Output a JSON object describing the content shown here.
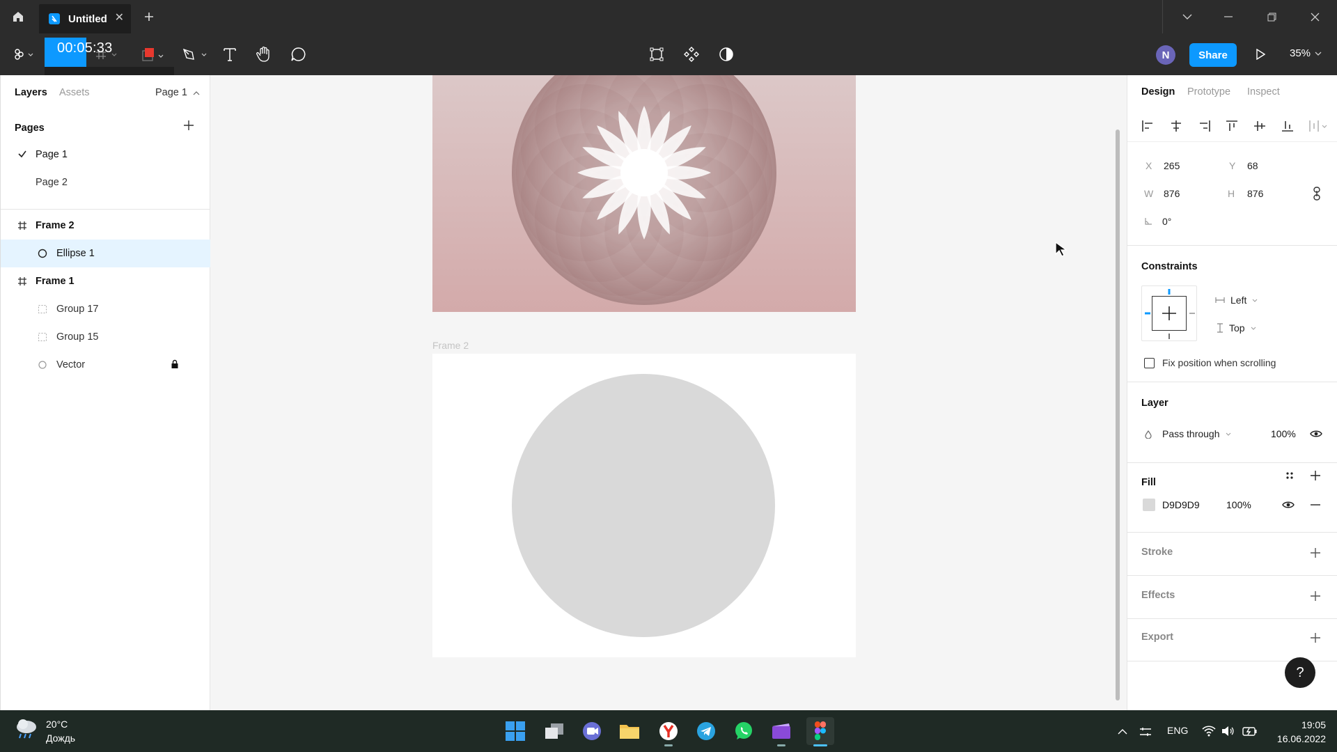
{
  "titlebar": {
    "tab_title": "Untitled",
    "tab_close": "✕",
    "new_tab": "+"
  },
  "toolbar": {
    "timer": "00:05:33",
    "avatar_initial": "N",
    "share_label": "Share",
    "zoom": "35%",
    "fill_swatch_color": "#e8382e"
  },
  "left_panel": {
    "tabs": [
      "Layers",
      "Assets"
    ],
    "page_selector": "Page 1",
    "pages_header": "Pages",
    "pages": [
      {
        "label": "Page 1",
        "current": true
      },
      {
        "label": "Page 2",
        "current": false
      }
    ],
    "layers": [
      {
        "label": "Frame 2",
        "type": "frame",
        "selected": false
      },
      {
        "label": "Ellipse 1",
        "type": "ellipse",
        "selected": true
      },
      {
        "label": "Frame 1",
        "type": "frame",
        "selected": false
      },
      {
        "label": "Group 17",
        "type": "group",
        "selected": false
      },
      {
        "label": "Group 15",
        "type": "group",
        "selected": false
      },
      {
        "label": "Vector",
        "type": "vector",
        "selected": false,
        "locked": true
      }
    ]
  },
  "canvas": {
    "frame2_label": "Frame 2",
    "ellipse_color": "#d9d9d9"
  },
  "right_panel": {
    "tabs": [
      "Design",
      "Prototype",
      "Inspect"
    ],
    "position": {
      "x_label": "X",
      "x": "265",
      "y_label": "Y",
      "y": "68"
    },
    "size": {
      "w_label": "W",
      "w": "876",
      "h_label": "H",
      "h": "876"
    },
    "rotation": "0°",
    "constraints": {
      "title": "Constraints",
      "horizontal": "Left",
      "vertical": "Top",
      "fix_position_label": "Fix position when scrolling"
    },
    "layer": {
      "title": "Layer",
      "blend": "Pass through",
      "opacity": "100%"
    },
    "fill": {
      "title": "Fill",
      "hex": "D9D9D9",
      "opacity": "100%"
    },
    "stroke": {
      "title": "Stroke"
    },
    "effects": {
      "title": "Effects"
    },
    "export": {
      "title": "Export"
    },
    "help": "?"
  },
  "taskbar": {
    "weather_temp": "20°C",
    "weather_cond": "Дождь",
    "lang": "ENG",
    "time": "19:05",
    "date": "16.06.2022"
  }
}
